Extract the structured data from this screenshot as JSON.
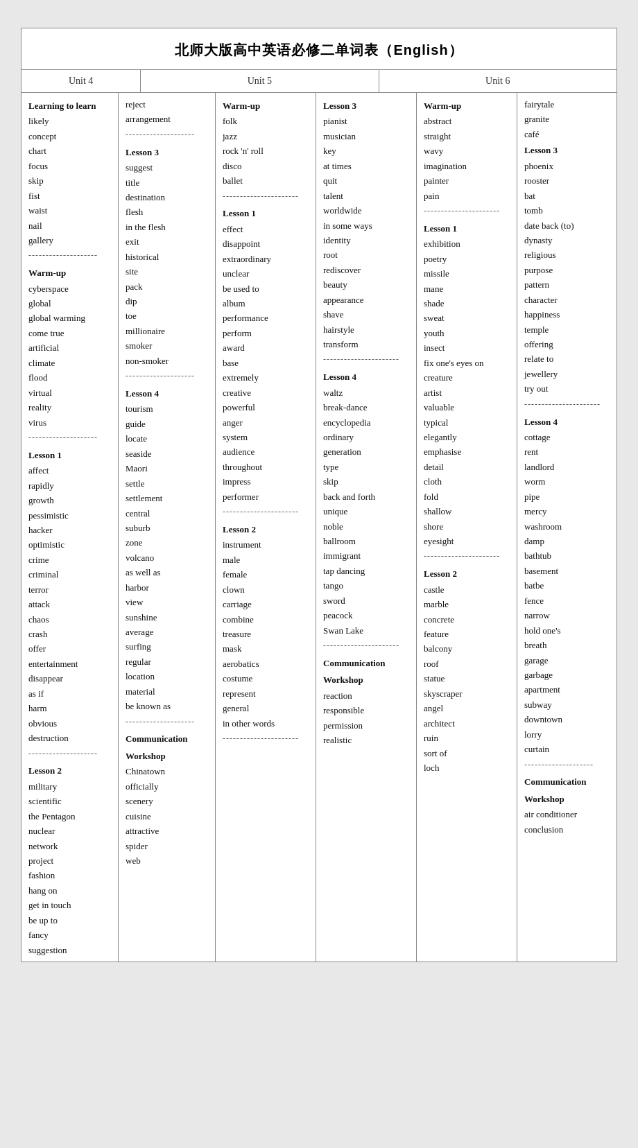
{
  "title": "北师大版高中英语必修二单词表（English）",
  "unit4_header": "Unit 4",
  "unit5_header": "Unit 5",
  "unit6_header": "Unit 6",
  "unit4_left": [
    {
      "type": "section",
      "text": "Learning to learn"
    },
    {
      "type": "word",
      "text": "likely"
    },
    {
      "type": "word",
      "text": "concept"
    },
    {
      "type": "word",
      "text": "chart"
    },
    {
      "type": "word",
      "text": "focus"
    },
    {
      "type": "word",
      "text": "skip"
    },
    {
      "type": "word",
      "text": "fist"
    },
    {
      "type": "word",
      "text": "waist"
    },
    {
      "type": "word",
      "text": "nail"
    },
    {
      "type": "word",
      "text": "gallery"
    },
    {
      "type": "divider",
      "text": "--------------------"
    },
    {
      "type": "section",
      "text": "Warm-up"
    },
    {
      "type": "word",
      "text": "cyberspace"
    },
    {
      "type": "word",
      "text": "global"
    },
    {
      "type": "word",
      "text": "global warming"
    },
    {
      "type": "word",
      "text": "come true"
    },
    {
      "type": "word",
      "text": "artificial"
    },
    {
      "type": "word",
      "text": "climate"
    },
    {
      "type": "word",
      "text": "flood"
    },
    {
      "type": "word",
      "text": "virtual"
    },
    {
      "type": "word",
      "text": "reality"
    },
    {
      "type": "word",
      "text": "virus"
    },
    {
      "type": "divider",
      "text": "--------------------"
    },
    {
      "type": "section",
      "text": "Lesson 1"
    },
    {
      "type": "word",
      "text": "affect"
    },
    {
      "type": "word",
      "text": "rapidly"
    },
    {
      "type": "word",
      "text": "growth"
    },
    {
      "type": "word",
      "text": "pessimistic"
    },
    {
      "type": "word",
      "text": "hacker"
    },
    {
      "type": "word",
      "text": "optimistic"
    },
    {
      "type": "word",
      "text": "crime"
    },
    {
      "type": "word",
      "text": "criminal"
    },
    {
      "type": "word",
      "text": "terror"
    },
    {
      "type": "word",
      "text": "attack"
    },
    {
      "type": "word",
      "text": "chaos"
    },
    {
      "type": "word",
      "text": "crash"
    },
    {
      "type": "word",
      "text": "offer"
    },
    {
      "type": "word",
      "text": "entertainment"
    },
    {
      "type": "word",
      "text": "disappear"
    },
    {
      "type": "word",
      "text": "as if"
    },
    {
      "type": "word",
      "text": "harm"
    },
    {
      "type": "word",
      "text": "obvious"
    },
    {
      "type": "word",
      "text": "destruction"
    },
    {
      "type": "divider",
      "text": "--------------------"
    },
    {
      "type": "section",
      "text": "Lesson 2"
    },
    {
      "type": "word",
      "text": "military"
    },
    {
      "type": "word",
      "text": "scientific"
    },
    {
      "type": "word",
      "text": "the Pentagon"
    },
    {
      "type": "word",
      "text": "nuclear"
    },
    {
      "type": "word",
      "text": "network"
    },
    {
      "type": "word",
      "text": "project"
    },
    {
      "type": "word",
      "text": "fashion"
    },
    {
      "type": "word",
      "text": "hang on"
    },
    {
      "type": "word",
      "text": "get in touch"
    },
    {
      "type": "word",
      "text": "be up to"
    },
    {
      "type": "word",
      "text": "fancy"
    },
    {
      "type": "word",
      "text": "suggestion"
    }
  ],
  "unit4_right": [
    {
      "type": "word",
      "text": "reject"
    },
    {
      "type": "word",
      "text": "arrangement"
    },
    {
      "type": "divider",
      "text": "--------------------"
    },
    {
      "type": "section",
      "text": "Lesson 3"
    },
    {
      "type": "word",
      "text": "suggest"
    },
    {
      "type": "word",
      "text": "title"
    },
    {
      "type": "word",
      "text": "destination"
    },
    {
      "type": "word",
      "text": "flesh"
    },
    {
      "type": "word",
      "text": "in the flesh"
    },
    {
      "type": "word",
      "text": "exit"
    },
    {
      "type": "word",
      "text": "historical"
    },
    {
      "type": "word",
      "text": "site"
    },
    {
      "type": "word",
      "text": "pack"
    },
    {
      "type": "word",
      "text": "dip"
    },
    {
      "type": "word",
      "text": "toe"
    },
    {
      "type": "word",
      "text": "millionaire"
    },
    {
      "type": "word",
      "text": "smoker"
    },
    {
      "type": "word",
      "text": "non-smoker"
    },
    {
      "type": "divider",
      "text": "--------------------"
    },
    {
      "type": "section",
      "text": "Lesson 4"
    },
    {
      "type": "word",
      "text": "tourism"
    },
    {
      "type": "word",
      "text": "guide"
    },
    {
      "type": "word",
      "text": "locate"
    },
    {
      "type": "word",
      "text": "seaside"
    },
    {
      "type": "word",
      "text": "Maori"
    },
    {
      "type": "word",
      "text": "settle"
    },
    {
      "type": "word",
      "text": "settlement"
    },
    {
      "type": "word",
      "text": "central"
    },
    {
      "type": "word",
      "text": "suburb"
    },
    {
      "type": "word",
      "text": "zone"
    },
    {
      "type": "word",
      "text": "volcano"
    },
    {
      "type": "word",
      "text": "as well as"
    },
    {
      "type": "word",
      "text": "harbor"
    },
    {
      "type": "word",
      "text": "view"
    },
    {
      "type": "word",
      "text": "sunshine"
    },
    {
      "type": "word",
      "text": "average"
    },
    {
      "type": "word",
      "text": "surfing"
    },
    {
      "type": "word",
      "text": "regular"
    },
    {
      "type": "word",
      "text": "location"
    },
    {
      "type": "word",
      "text": "material"
    },
    {
      "type": "word",
      "text": "be known as"
    },
    {
      "type": "divider",
      "text": "--------------------"
    },
    {
      "type": "section",
      "text": "Communication"
    },
    {
      "type": "section",
      "text": "Workshop"
    },
    {
      "type": "word",
      "text": "Chinatown"
    },
    {
      "type": "word",
      "text": "officially"
    },
    {
      "type": "word",
      "text": "scenery"
    },
    {
      "type": "word",
      "text": "cuisine"
    },
    {
      "type": "word",
      "text": "attractive"
    },
    {
      "type": "word",
      "text": "spider"
    },
    {
      "type": "word",
      "text": "web"
    }
  ],
  "unit5_left": [
    {
      "type": "section",
      "text": "Warm-up"
    },
    {
      "type": "word",
      "text": "folk"
    },
    {
      "type": "word",
      "text": "jazz"
    },
    {
      "type": "word",
      "text": "rock 'n' roll"
    },
    {
      "type": "word",
      "text": "disco"
    },
    {
      "type": "word",
      "text": "ballet"
    },
    {
      "type": "divider",
      "text": "----------------------"
    },
    {
      "type": "section",
      "text": "Lesson 1"
    },
    {
      "type": "word",
      "text": "effect"
    },
    {
      "type": "word",
      "text": "disappoint"
    },
    {
      "type": "word",
      "text": "extraordinary"
    },
    {
      "type": "word",
      "text": "unclear"
    },
    {
      "type": "word",
      "text": "be used to"
    },
    {
      "type": "word",
      "text": "album"
    },
    {
      "type": "word",
      "text": "performance"
    },
    {
      "type": "word",
      "text": "perform"
    },
    {
      "type": "word",
      "text": "award"
    },
    {
      "type": "word",
      "text": "base"
    },
    {
      "type": "word",
      "text": "extremely"
    },
    {
      "type": "word",
      "text": "creative"
    },
    {
      "type": "word",
      "text": "powerful"
    },
    {
      "type": "word",
      "text": "anger"
    },
    {
      "type": "word",
      "text": "system"
    },
    {
      "type": "word",
      "text": "audience"
    },
    {
      "type": "word",
      "text": "throughout"
    },
    {
      "type": "word",
      "text": "impress"
    },
    {
      "type": "word",
      "text": "performer"
    },
    {
      "type": "divider",
      "text": "----------------------"
    },
    {
      "type": "section",
      "text": "Lesson 2"
    },
    {
      "type": "word",
      "text": "instrument"
    },
    {
      "type": "word",
      "text": "male"
    },
    {
      "type": "word",
      "text": "female"
    },
    {
      "type": "word",
      "text": "clown"
    },
    {
      "type": "word",
      "text": "carriage"
    },
    {
      "type": "word",
      "text": "combine"
    },
    {
      "type": "word",
      "text": "treasure"
    },
    {
      "type": "word",
      "text": "mask"
    },
    {
      "type": "word",
      "text": "aerobatics"
    },
    {
      "type": "word",
      "text": "costume"
    },
    {
      "type": "word",
      "text": "represent"
    },
    {
      "type": "word",
      "text": "general"
    },
    {
      "type": "word",
      "text": "in other words"
    },
    {
      "type": "divider",
      "text": "----------------------"
    }
  ],
  "unit5_right": [
    {
      "type": "section",
      "text": "Lesson 3"
    },
    {
      "type": "word",
      "text": "pianist"
    },
    {
      "type": "word",
      "text": "musician"
    },
    {
      "type": "word",
      "text": "key"
    },
    {
      "type": "word",
      "text": "at times"
    },
    {
      "type": "word",
      "text": "quit"
    },
    {
      "type": "word",
      "text": "talent"
    },
    {
      "type": "word",
      "text": "worldwide"
    },
    {
      "type": "word",
      "text": "in some ways"
    },
    {
      "type": "word",
      "text": "identity"
    },
    {
      "type": "word",
      "text": "root"
    },
    {
      "type": "word",
      "text": "rediscover"
    },
    {
      "type": "word",
      "text": "beauty"
    },
    {
      "type": "word",
      "text": "appearance"
    },
    {
      "type": "word",
      "text": "shave"
    },
    {
      "type": "word",
      "text": "hairstyle"
    },
    {
      "type": "word",
      "text": "transform"
    },
    {
      "type": "divider",
      "text": "----------------------"
    },
    {
      "type": "section",
      "text": "Lesson 4"
    },
    {
      "type": "word",
      "text": "waltz"
    },
    {
      "type": "word",
      "text": "break-dance"
    },
    {
      "type": "word",
      "text": "encyclopedia"
    },
    {
      "type": "word",
      "text": "ordinary"
    },
    {
      "type": "word",
      "text": "generation"
    },
    {
      "type": "word",
      "text": "type"
    },
    {
      "type": "word",
      "text": "skip"
    },
    {
      "type": "word",
      "text": "back and forth"
    },
    {
      "type": "word",
      "text": "unique"
    },
    {
      "type": "word",
      "text": "noble"
    },
    {
      "type": "word",
      "text": "ballroom"
    },
    {
      "type": "word",
      "text": "immigrant"
    },
    {
      "type": "word",
      "text": "tap dancing"
    },
    {
      "type": "word",
      "text": "tango"
    },
    {
      "type": "word",
      "text": "sword"
    },
    {
      "type": "word",
      "text": "peacock"
    },
    {
      "type": "word",
      "text": "Swan Lake"
    },
    {
      "type": "divider",
      "text": "----------------------"
    },
    {
      "type": "section",
      "text": "Communication"
    },
    {
      "type": "section",
      "text": "Workshop"
    },
    {
      "type": "word",
      "text": "reaction"
    },
    {
      "type": "word",
      "text": "responsible"
    },
    {
      "type": "word",
      "text": "permission"
    },
    {
      "type": "word",
      "text": "realistic"
    }
  ],
  "unit6_left": [
    {
      "type": "section",
      "text": "Warm-up"
    },
    {
      "type": "word",
      "text": "abstract"
    },
    {
      "type": "word",
      "text": "straight"
    },
    {
      "type": "word",
      "text": "wavy"
    },
    {
      "type": "word",
      "text": "imagination"
    },
    {
      "type": "word",
      "text": "painter"
    },
    {
      "type": "word",
      "text": "pain"
    },
    {
      "type": "divider",
      "text": "----------------------"
    },
    {
      "type": "section",
      "text": "Lesson 1"
    },
    {
      "type": "word",
      "text": "exhibition"
    },
    {
      "type": "word",
      "text": "poetry"
    },
    {
      "type": "word",
      "text": "missile"
    },
    {
      "type": "word",
      "text": "mane"
    },
    {
      "type": "word",
      "text": "shade"
    },
    {
      "type": "word",
      "text": "sweat"
    },
    {
      "type": "word",
      "text": "youth"
    },
    {
      "type": "word",
      "text": "insect"
    },
    {
      "type": "word",
      "text": "fix one's eyes on"
    },
    {
      "type": "word",
      "text": "creature"
    },
    {
      "type": "word",
      "text": "artist"
    },
    {
      "type": "word",
      "text": "valuable"
    },
    {
      "type": "word",
      "text": "typical"
    },
    {
      "type": "word",
      "text": "elegantly"
    },
    {
      "type": "word",
      "text": "emphasise"
    },
    {
      "type": "word",
      "text": "detail"
    },
    {
      "type": "word",
      "text": "cloth"
    },
    {
      "type": "word",
      "text": "fold"
    },
    {
      "type": "word",
      "text": "shallow"
    },
    {
      "type": "word",
      "text": "shore"
    },
    {
      "type": "word",
      "text": "eyesight"
    },
    {
      "type": "divider",
      "text": "----------------------"
    },
    {
      "type": "section",
      "text": "Lesson 2"
    },
    {
      "type": "word",
      "text": "castle"
    },
    {
      "type": "word",
      "text": "marble"
    },
    {
      "type": "word",
      "text": "concrete"
    },
    {
      "type": "word",
      "text": "feature"
    },
    {
      "type": "word",
      "text": "balcony"
    },
    {
      "type": "word",
      "text": "roof"
    },
    {
      "type": "word",
      "text": "statue"
    },
    {
      "type": "word",
      "text": "skyscraper"
    },
    {
      "type": "word",
      "text": "angel"
    },
    {
      "type": "word",
      "text": "architect"
    },
    {
      "type": "word",
      "text": "ruin"
    },
    {
      "type": "word",
      "text": "sort of"
    },
    {
      "type": "word",
      "text": "loch"
    }
  ],
  "unit6_right": [
    {
      "type": "word",
      "text": "fairytale"
    },
    {
      "type": "word",
      "text": "granite"
    },
    {
      "type": "word",
      "text": "café"
    },
    {
      "type": "section",
      "text": "Lesson 3"
    },
    {
      "type": "word",
      "text": "phoenix"
    },
    {
      "type": "word",
      "text": "rooster"
    },
    {
      "type": "word",
      "text": "bat"
    },
    {
      "type": "word",
      "text": "tomb"
    },
    {
      "type": "word",
      "text": "date back (to)"
    },
    {
      "type": "word",
      "text": "dynasty"
    },
    {
      "type": "word",
      "text": "religious"
    },
    {
      "type": "word",
      "text": "purpose"
    },
    {
      "type": "word",
      "text": "pattern"
    },
    {
      "type": "word",
      "text": "character"
    },
    {
      "type": "word",
      "text": "happiness"
    },
    {
      "type": "word",
      "text": "temple"
    },
    {
      "type": "word",
      "text": "offering"
    },
    {
      "type": "word",
      "text": "relate to"
    },
    {
      "type": "word",
      "text": "jewellery"
    },
    {
      "type": "word",
      "text": "try out"
    },
    {
      "type": "divider",
      "text": "----------------------"
    },
    {
      "type": "section",
      "text": "Lesson 4"
    },
    {
      "type": "word",
      "text": "cottage"
    },
    {
      "type": "word",
      "text": "rent"
    },
    {
      "type": "word",
      "text": "landlord"
    },
    {
      "type": "word",
      "text": "worm"
    },
    {
      "type": "word",
      "text": "pipe"
    },
    {
      "type": "word",
      "text": "mercy"
    },
    {
      "type": "word",
      "text": "washroom"
    },
    {
      "type": "word",
      "text": "damp"
    },
    {
      "type": "word",
      "text": "bathtub"
    },
    {
      "type": "word",
      "text": "basement"
    },
    {
      "type": "word",
      "text": "batbe"
    },
    {
      "type": "word",
      "text": "fence"
    },
    {
      "type": "word",
      "text": "narrow"
    },
    {
      "type": "word",
      "text": "hold one's"
    },
    {
      "type": "word",
      "text": "breath"
    },
    {
      "type": "word",
      "text": "garage"
    },
    {
      "type": "word",
      "text": "garbage"
    },
    {
      "type": "word",
      "text": "apartment"
    },
    {
      "type": "word",
      "text": "subway"
    },
    {
      "type": "word",
      "text": "downtown"
    },
    {
      "type": "word",
      "text": "lorry"
    },
    {
      "type": "word",
      "text": "curtain"
    },
    {
      "type": "divider",
      "text": "--------------------"
    },
    {
      "type": "section",
      "text": "Communication"
    },
    {
      "type": "section",
      "text": "Workshop"
    },
    {
      "type": "word",
      "text": "air conditioner"
    },
    {
      "type": "word",
      "text": "conclusion"
    }
  ]
}
